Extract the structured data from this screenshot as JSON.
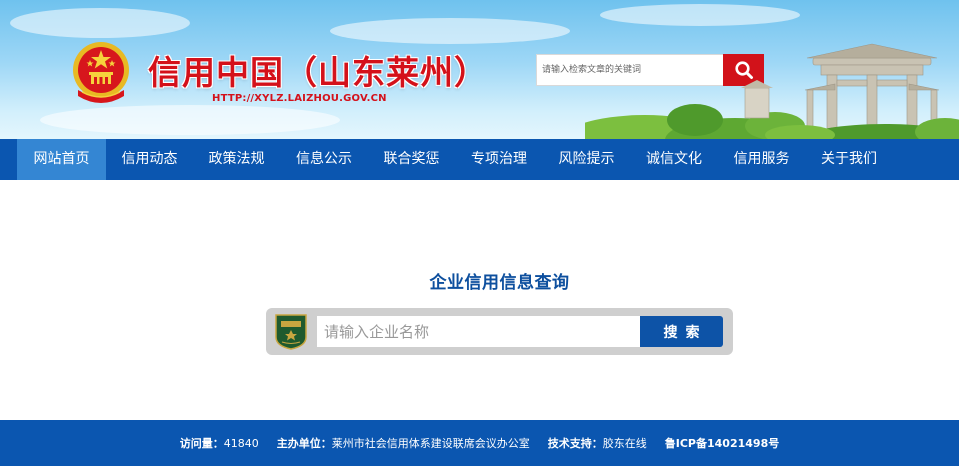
{
  "header": {
    "title": "信用中国（山东莱州）",
    "url": "HTTP://XYLZ.LAIZHOU.GOV.CN",
    "search": {
      "placeholder": "请输入检索文章的关键词",
      "button_icon": "search-icon"
    },
    "emblem_icon": "national-emblem-icon",
    "scenery_icon": "archway-landscape-icon"
  },
  "nav": {
    "items": [
      {
        "label": "网站首页",
        "active": true
      },
      {
        "label": "信用动态",
        "active": false
      },
      {
        "label": "政策法规",
        "active": false
      },
      {
        "label": "信息公示",
        "active": false
      },
      {
        "label": "联合奖惩",
        "active": false
      },
      {
        "label": "专项治理",
        "active": false
      },
      {
        "label": "风险提示",
        "active": false
      },
      {
        "label": "诚信文化",
        "active": false
      },
      {
        "label": "信用服务",
        "active": false
      },
      {
        "label": "关于我们",
        "active": false
      }
    ]
  },
  "query": {
    "title": "企业信用信息查询",
    "placeholder": "请输入企业名称",
    "button_label": "搜索",
    "badge_icon": "credit-badge-icon"
  },
  "footer": {
    "visits_label": "访问量：",
    "visits_value": "41840",
    "host_label": "主办单位：",
    "host_value": "莱州市社会信用体系建设联席会议办公室",
    "support_label": "技术支持：",
    "support_value": "胶东在线",
    "icp": "鲁ICP备14021498号"
  },
  "colors": {
    "nav_bg": "#0b56b0",
    "nav_active": "#3486d3",
    "title_red": "#d4111a",
    "query_title": "#0d4f9e",
    "search_red": "#d2121a"
  }
}
